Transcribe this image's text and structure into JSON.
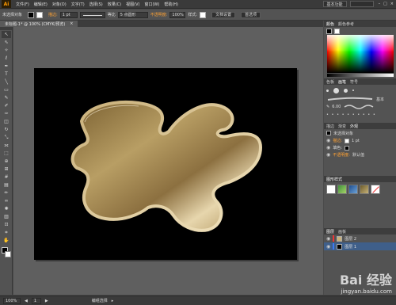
{
  "app": {
    "logo": "Ai",
    "logo_color": "#ff9a00"
  },
  "menu": [
    "文件(F)",
    "编辑(E)",
    "对象(O)",
    "文字(T)",
    "选择(S)",
    "效果(C)",
    "视图(V)",
    "窗口(W)",
    "帮助(H)"
  ],
  "workspace_buttons": [
    "基本功能"
  ],
  "control": {
    "selection_label": "未选择对象",
    "stroke_label": "描边:",
    "stroke_weight": "1 pt",
    "profile_label": "等比",
    "brush": "5 点圆形",
    "opacity_label": "不透明度:",
    "opacity": "100%",
    "style_label": "样式:",
    "doc_setup": "文档设置",
    "prefs": "首选项"
  },
  "document_tab": {
    "title": "未标题-1* @ 100% (CMYK/预览)",
    "close": "×"
  },
  "tools": [
    {
      "name": "selection-tool",
      "glyph": "↖"
    },
    {
      "name": "direct-selection-tool",
      "glyph": "⇖"
    },
    {
      "name": "magic-wand-tool",
      "glyph": "✧"
    },
    {
      "name": "lasso-tool",
      "glyph": "ℓ"
    },
    {
      "name": "pen-tool",
      "glyph": "✒"
    },
    {
      "name": "type-tool",
      "glyph": "T"
    },
    {
      "name": "line-tool",
      "glyph": "╲"
    },
    {
      "name": "rectangle-tool",
      "glyph": "▭"
    },
    {
      "name": "paintbrush-tool",
      "glyph": "✎"
    },
    {
      "name": "pencil-tool",
      "glyph": "✐"
    },
    {
      "name": "blob-brush-tool",
      "glyph": "✑"
    },
    {
      "name": "eraser-tool",
      "glyph": "◫"
    },
    {
      "name": "rotate-tool",
      "glyph": "↻"
    },
    {
      "name": "scale-tool",
      "glyph": "⤡"
    },
    {
      "name": "width-tool",
      "glyph": "⟗"
    },
    {
      "name": "free-transform-tool",
      "glyph": "⬚"
    },
    {
      "name": "shape-builder-tool",
      "glyph": "⊕"
    },
    {
      "name": "perspective-grid-tool",
      "glyph": "⊞"
    },
    {
      "name": "mesh-tool",
      "glyph": "#"
    },
    {
      "name": "gradient-tool",
      "glyph": "▤"
    },
    {
      "name": "eyedropper-tool",
      "glyph": "✏"
    },
    {
      "name": "blend-tool",
      "glyph": "∞"
    },
    {
      "name": "symbol-sprayer-tool",
      "glyph": "✺"
    },
    {
      "name": "column-graph-tool",
      "glyph": "▥"
    },
    {
      "name": "artboard-tool",
      "glyph": "⊡"
    },
    {
      "name": "slice-tool",
      "glyph": "⌗"
    },
    {
      "name": "hand-tool",
      "glyph": "✋"
    },
    {
      "name": "zoom-tool",
      "glyph": "⌕"
    }
  ],
  "panels": {
    "color": {
      "tabs": [
        "颜色",
        "颜色参考"
      ]
    },
    "brushes": {
      "tabs": [
        "色板",
        "画笔",
        "符号"
      ],
      "stroke_size": "6.00",
      "label": "基本"
    },
    "appearance": {
      "tabs": [
        "描边",
        "渐变",
        "外观"
      ],
      "title": "未选择对象",
      "stroke_label": "描边:",
      "stroke_weight": "1 pt",
      "fill_label": "填色:",
      "opacity_label": "不透明度:",
      "opacity_value": "默认值"
    },
    "graphic_styles": {
      "tabs": [
        "图形样式"
      ]
    },
    "layers": {
      "tabs": [
        "图层",
        "画板"
      ],
      "rows": [
        "图层 2",
        "图层 1"
      ]
    }
  },
  "status": {
    "zoom": "100%",
    "page": "1",
    "tool": "编组选择"
  },
  "watermark": {
    "brand": "Bai 经验",
    "url": "jingyan.baidu.com"
  },
  "colors": {
    "shape_light": "#e7d6ad",
    "shape_mid": "#b89e64",
    "shape_dark": "#7a6031",
    "accent": "#ffa233"
  }
}
